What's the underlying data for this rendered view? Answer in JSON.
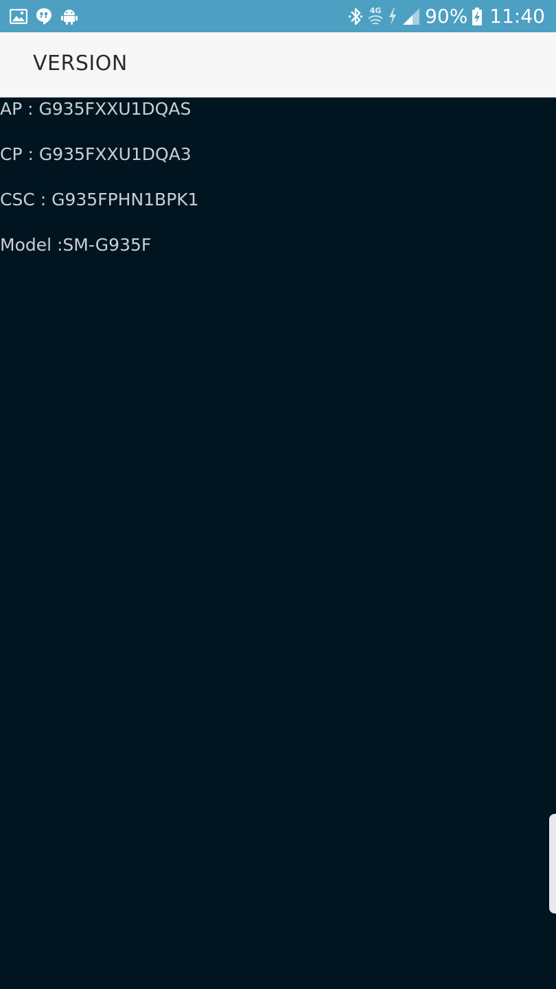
{
  "status_bar": {
    "left_icons": [
      "gallery-icon",
      "hangouts-icon",
      "android-icon"
    ],
    "right_icons": [
      "bluetooth-icon",
      "wifi-icon",
      "lte-charging-icon",
      "signal-icon"
    ],
    "network_label": "4G",
    "battery_percent": "90%",
    "time": "11:40",
    "background_color": "#4da0c2"
  },
  "app_bar": {
    "title": "VERSION",
    "background_color": "#f7f7f7"
  },
  "version_info": {
    "lines": [
      {
        "label": "AP : G935FXXU1DQAS"
      },
      {
        "label": "CP : G935FXXU1DQA3"
      },
      {
        "label": "CSC : G935FPHN1BPK1"
      },
      {
        "label": "Model :SM-G935F"
      }
    ],
    "background_color": "#011520",
    "text_color": "#c9d0d4"
  }
}
